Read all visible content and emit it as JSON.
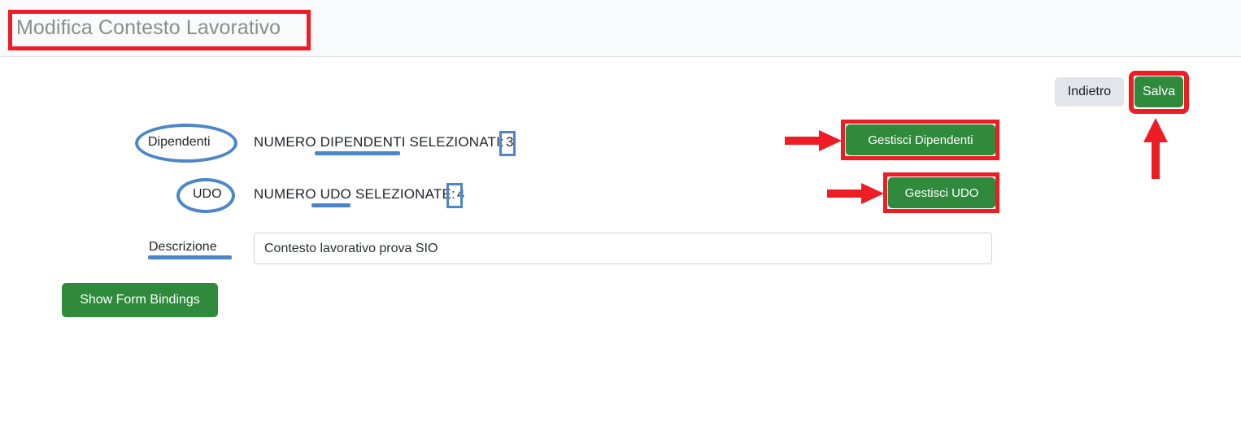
{
  "header": {
    "title": "Modifica Contesto Lavorativo"
  },
  "actions": {
    "back_label": "Indietro",
    "save_label": "Salva"
  },
  "form": {
    "rows": [
      {
        "label": "Dipendenti",
        "counter_prefix": "NUMERO DIPENDENTI SELEZIONATI:",
        "counter_value": "3",
        "button_label": "Gestisci Dipendenti"
      },
      {
        "label": "UDO",
        "counter_prefix": "NUMERO UDO SELEZIONATE:",
        "counter_value": "4",
        "button_label": "Gestisci UDO"
      }
    ],
    "description": {
      "label": "Descrizione",
      "value": "Contesto lavorativo prova SIO",
      "placeholder": ""
    },
    "show_bindings_label": "Show Form Bindings"
  },
  "colors": {
    "annotation_red": "#ee1c25",
    "annotation_blue": "#4a86c8",
    "button_green": "#2f8a3c",
    "button_secondary": "#e2e6ea",
    "title_gray": "#8c8c8c",
    "header_background": "#f8fafc"
  }
}
